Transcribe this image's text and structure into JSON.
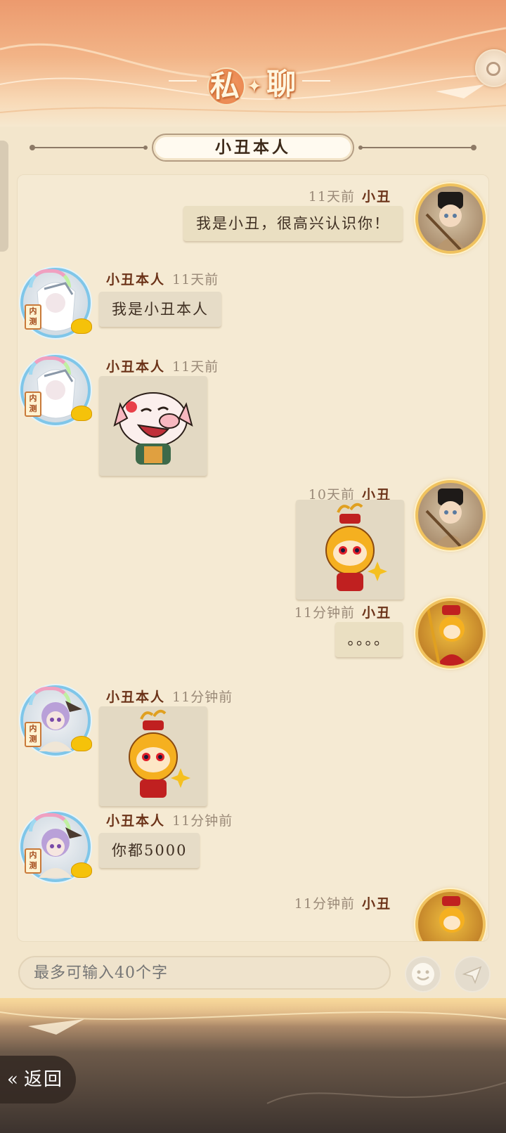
{
  "header": {
    "title_left": "私",
    "title_right": "聊"
  },
  "recipient": {
    "name": "小丑本人"
  },
  "messages": [
    {
      "side": "right",
      "name": "小丑",
      "time": "11天前",
      "text": "我是小丑，很高兴认识你！"
    },
    {
      "side": "left",
      "name": "小丑本人",
      "time": "11天前",
      "text": "我是小丑本人",
      "badge": "内测"
    },
    {
      "side": "left",
      "name": "小丑本人",
      "time": "11天前",
      "sticker": "laughing-pig-sticker",
      "badge": "内测"
    },
    {
      "side": "right",
      "name": "小丑",
      "time": "10天前",
      "sticker": "monkey-king-sticker"
    },
    {
      "side": "right",
      "name": "小丑",
      "time": "11分钟前",
      "text": "。。。。"
    },
    {
      "side": "left",
      "name": "小丑本人",
      "time": "11分钟前",
      "sticker": "monkey-king-sticker",
      "badge": "内测"
    },
    {
      "side": "left",
      "name": "小丑本人",
      "time": "11分钟前",
      "text": "你都5000",
      "badge": "内测"
    },
    {
      "side": "right",
      "name": "小丑",
      "time": "11分钟前"
    }
  ],
  "input": {
    "placeholder": "最多可输入40个字"
  },
  "buttons": {
    "emoji": "emoji-icon",
    "send": "send-icon",
    "back_label": "返回"
  },
  "colors": {
    "accent": "#ec9a6e",
    "name": "#6b3218",
    "time": "#9a8a78",
    "bubble": "#e6dcc7"
  }
}
